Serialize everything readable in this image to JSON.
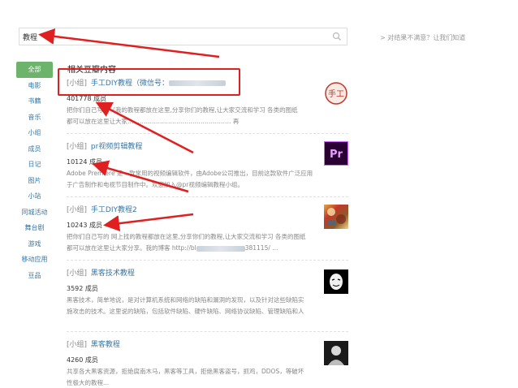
{
  "search": {
    "value": "教程"
  },
  "side_hint": "> 对结果不满意？让我们知道",
  "nav": [
    "全部",
    "电影",
    "书籍",
    "音乐",
    "小组",
    "成员",
    "日记",
    "图片",
    "小站",
    "同城活动",
    "舞台剧",
    "游戏",
    "移动应用",
    "豆品"
  ],
  "section_title": "相关豆瓣内容",
  "results": [
    {
      "type": "[小组]",
      "name": "手工DIY教程（微信号：",
      "members": "401778 成员",
      "desc1": "把你们自己写的（我的教程都放在这里,分享你们的教程,让大家交流和学习 各类的图纸",
      "desc2": "都可以放在这里让大家…………………………………………… 再",
      "thumb_text": "手工"
    },
    {
      "type": "[小组]",
      "name": "pr视频剪辑教程",
      "members": "10124 成员",
      "desc1": "Adobe Premiere 是一款常用的视频编辑软件，由Adobe公司推出，目前这款软件广泛应用",
      "desc2": "于广告制作和电视节目制作中。欢迎加入@pr视频编辑教程小组。",
      "thumb_text": "Pr"
    },
    {
      "type": "[小组]",
      "name": "手工DIY教程2",
      "members": "10243 成员",
      "desc1": "把你们自己写的 网上找的教程都放在这里,分享你们的教程,让大家交流和学习 各类的图纸",
      "desc2": "都可以放在这里让大家分享。我的博客 http://bl",
      "desc2_tail": "381115/ ...",
      "thumb_text": ""
    },
    {
      "type": "[小组]",
      "name": "黑客技术教程",
      "members": "3592 成员",
      "desc1": "黑客技术，简单地说，是对计算机系统和网络的缺陷和漏洞的发现，以及针对这些缺陷实",
      "desc2": "施攻击的技术。这里说的缺陷，包括软件缺陷、硬件缺陷、网络协议缺陷、管理缺陷和人",
      "desc3": "",
      "thumb_text": ""
    },
    {
      "type": "[小组]",
      "name": "黑客教程",
      "members": "4260 成员",
      "desc1": "共享各大黑客资源，拒绝腐南木马，黑客等工具，拒绝黑客盗号，抓鸡，DDOS，等破坏",
      "desc2": "性极大的教程...",
      "thumb_text": ""
    }
  ],
  "colors": {
    "accent": "#6db36b",
    "link": "#3377aa",
    "annotation": "#e02020"
  }
}
